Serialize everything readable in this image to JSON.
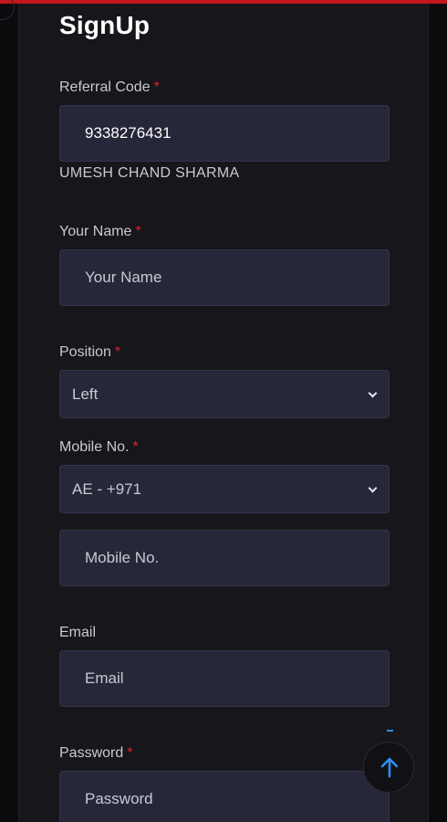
{
  "page": {
    "title": "SignUp",
    "required_marker": "*"
  },
  "referral": {
    "label": "Referral Code",
    "value": "9338276431",
    "sponsor_name": "UMESH CHAND SHARMA"
  },
  "name": {
    "label": "Your Name",
    "placeholder": "Your Name"
  },
  "position": {
    "label": "Position",
    "selected": "Left"
  },
  "mobile": {
    "label": "Mobile No.",
    "country_selected": "AE - +971",
    "placeholder": "Mobile No."
  },
  "email": {
    "label": "Email",
    "placeholder": "Email"
  },
  "password": {
    "label": "Password",
    "placeholder": "Password"
  },
  "colors": {
    "accent_red": "#c4161c",
    "required_red": "#e4202a",
    "field_bg": "#27273a",
    "card_bg": "#16161b",
    "scroll_arrow": "#2f8ff0"
  },
  "icons": {
    "scroll_top": "arrow-up-icon",
    "dropdown": "chevron-down-icon"
  }
}
